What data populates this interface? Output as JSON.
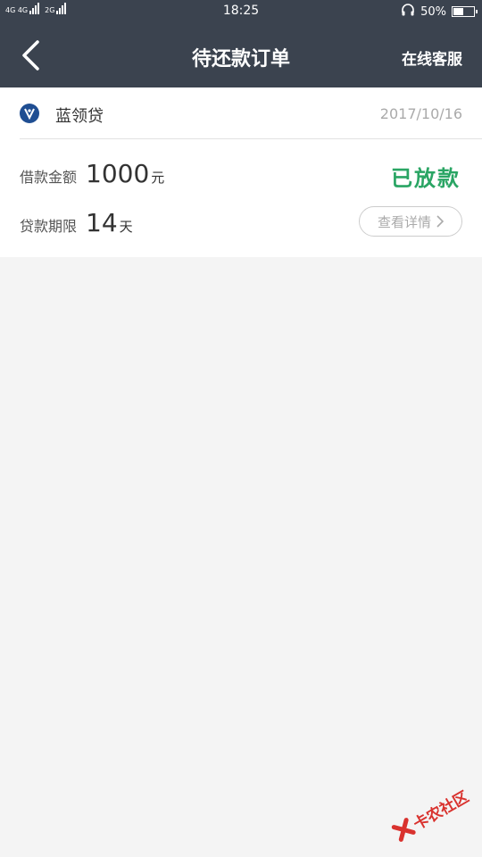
{
  "status_bar": {
    "network1": "4G 4G",
    "network2": "2G",
    "time": "18:25",
    "battery": "50%",
    "battery_level": 0.5,
    "icons": [
      "headphone-icon",
      "battery-icon"
    ]
  },
  "nav": {
    "title": "待还款订单",
    "action": "在线客服",
    "back_icon": "chevron-left-icon"
  },
  "order": {
    "lender": "蓝领贷",
    "date": "2017/10/16",
    "amount_label": "借款金额",
    "amount": "1000",
    "amount_unit": "元",
    "term_label": "贷款期限",
    "term": "14",
    "term_unit": "天",
    "status": "已放款",
    "detail_button": "查看详情"
  },
  "watermark": {
    "text": "卡农社区"
  },
  "colors": {
    "header": "#3b434f",
    "status_green": "#2aa564",
    "background": "#f4f4f4",
    "logo_blue": "#1f4e92",
    "watermark_red": "#d9322e"
  }
}
